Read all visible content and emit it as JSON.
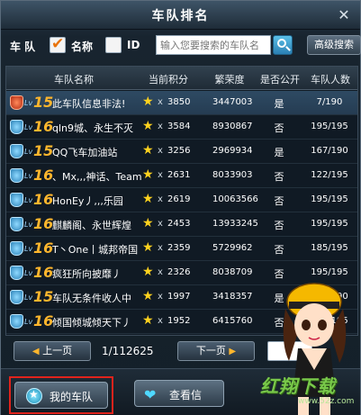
{
  "window": {
    "title": "车队排名",
    "close_label": "✕"
  },
  "filter": {
    "label_team": "车 队",
    "label_name": "名称",
    "label_id": "ID",
    "name_checked": true,
    "id_checked": false,
    "search_placeholder": "输入您要搜索的车队名",
    "advanced_search": "高级搜索"
  },
  "table": {
    "headers": [
      "车队名称",
      "当前积分",
      "繁荣度",
      "是否公开",
      "车队人数"
    ],
    "rows": [
      {
        "level": "15",
        "name": "此车队信息非法!",
        "score": "3850",
        "prosperity": "3447003",
        "public": "是",
        "members": "7/190",
        "badge": "red"
      },
      {
        "level": "16",
        "name": "qln9城、永生不灭",
        "score": "3584",
        "prosperity": "8930867",
        "public": "否",
        "members": "195/195",
        "badge": "blue"
      },
      {
        "level": "15",
        "name": "QQ飞车加油站",
        "score": "3256",
        "prosperity": "2969934",
        "public": "是",
        "members": "167/190",
        "badge": "blue"
      },
      {
        "level": "16",
        "name": "、Mx,,,神话、Team",
        "score": "2631",
        "prosperity": "8033903",
        "public": "否",
        "members": "122/195",
        "badge": "blue"
      },
      {
        "level": "16",
        "name": "HonEy丿,,,乐园",
        "score": "2619",
        "prosperity": "10063566",
        "public": "否",
        "members": "195/195",
        "badge": "blue"
      },
      {
        "level": "16",
        "name": "麒麟阁、永世辉煌",
        "score": "2453",
        "prosperity": "13933245",
        "public": "否",
        "members": "195/195",
        "badge": "blue"
      },
      {
        "level": "16",
        "name": "T丶One丨城邦帝国",
        "score": "2359",
        "prosperity": "5729962",
        "public": "否",
        "members": "185/195",
        "badge": "blue"
      },
      {
        "level": "16",
        "name": "疯狂所向披靡丿",
        "score": "2326",
        "prosperity": "8038709",
        "public": "否",
        "members": "195/195",
        "badge": "blue"
      },
      {
        "level": "15",
        "name": "车队无条件收人中",
        "score": "1997",
        "prosperity": "3418357",
        "public": "是",
        "members": "179/190",
        "badge": "blue"
      },
      {
        "level": "16",
        "name": "倾国倾城倾天下丿",
        "score": "1952",
        "prosperity": "6415760",
        "public": "否",
        "members": "195/195",
        "badge": "blue"
      }
    ]
  },
  "pager": {
    "prev_label": "上一页",
    "next_label": "下一页",
    "page_info": "1/112625"
  },
  "bottom": {
    "my_team_label": "我的车队",
    "view_label": "查看信"
  },
  "watermark": {
    "logo": "红翔下载",
    "url": "www.52z.com"
  },
  "colors": {
    "accent": "#ffb62d",
    "highlight_border": "#e0231c",
    "selected_row": "#2e4a63"
  }
}
